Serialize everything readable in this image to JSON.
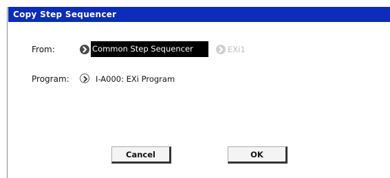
{
  "dialog": {
    "title": "Copy Step Sequencer",
    "from": {
      "label": "From:",
      "selected_value": "Common Step Sequencer",
      "alt_option": "EXi1"
    },
    "program": {
      "label": "Program:",
      "value": "I-A000: EXi Program"
    },
    "buttons": {
      "cancel": "Cancel",
      "ok": "OK"
    }
  },
  "colors": {
    "titlebar": "#0c2dbb",
    "selected_field": "#000000",
    "disabled": "#bcbcbc"
  }
}
